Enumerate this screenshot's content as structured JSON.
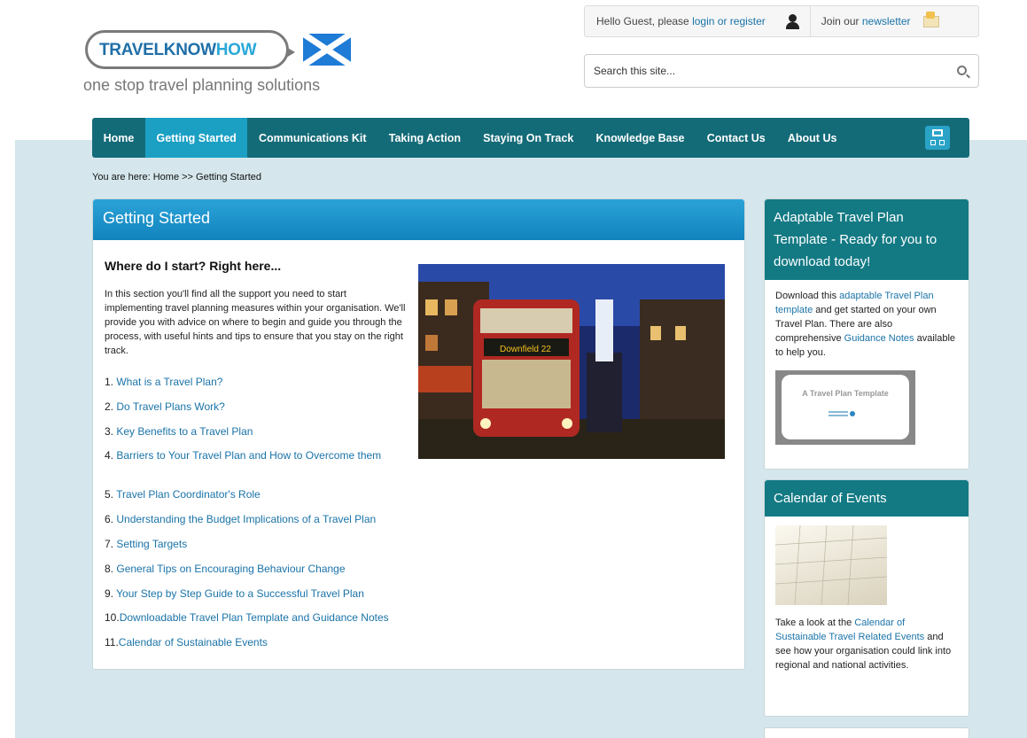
{
  "logo": {
    "text_a": "TRAVELKNOW",
    "text_b": "HOW",
    "tagline": "one stop travel planning solutions"
  },
  "userbar": {
    "greeting": "Hello Guest, please",
    "login_link": "login or register",
    "newsletter_prefix": "Join our",
    "newsletter_link": "newsletter"
  },
  "search": {
    "placeholder": "Search this site..."
  },
  "nav": {
    "items": [
      "Home",
      "Getting Started",
      "Communications Kit",
      "Taking Action",
      "Staying On Track",
      "Knowledge Base",
      "Contact Us",
      "About Us"
    ],
    "active": "Getting Started"
  },
  "breadcrumb": {
    "prefix": "You are here:",
    "home": "Home",
    "sep": ">>",
    "current": "Getting Started"
  },
  "main": {
    "title": "Getting Started",
    "heading": "Where do I start? Right here...",
    "intro": "In this section you'll find all the support you need to start implementing travel planning measures within your organisation. We'll provide you with advice on where to begin and guide you through the process, with useful hints and tips to ensure that you stay on the right track.",
    "topics": [
      {
        "num": "1.",
        "label": "What is a Travel Plan?"
      },
      {
        "num": "2.",
        "label": "Do Travel Plans Work?"
      },
      {
        "num": "3.",
        "label": "Key Benefits to a Travel Plan"
      },
      {
        "num": "4.",
        "label": "Barriers to Your Travel Plan and How to Overcome them"
      },
      {
        "num": "5.",
        "label": "Travel Plan Coordinator's Role"
      },
      {
        "num": "6.",
        "label": "Understanding the Budget Implications of a Travel Plan"
      },
      {
        "num": "7.",
        "label": "Setting Targets"
      },
      {
        "num": "8.",
        "label": "General Tips on Encouraging Behaviour Change"
      },
      {
        "num": "9.",
        "label": "Your Step by Step Guide to a Successful Travel Plan"
      },
      {
        "num": "10.",
        "label": "Downloadable Travel Plan Template and Guidance Notes"
      },
      {
        "num": "11.",
        "label": "Calendar of Sustainable Events"
      }
    ],
    "image_sign": "Downfield 22"
  },
  "sidebar": {
    "template_box": {
      "title": "Adaptable Travel Plan Template - Ready for you to download today!",
      "text_1": "Download this",
      "link_1": "adaptable Travel Plan template",
      "text_2": "and get started on your own Travel Plan. There are also comprehensive",
      "link_2": "Guidance Notes",
      "text_3": "available to help you.",
      "thumb_title": "A Travel Plan Template"
    },
    "calendar_box": {
      "title": "Calendar of Events",
      "text_1": "Take a look at the",
      "link_1": "Calendar of Sustainable Travel Related Events",
      "text_2": "and see how your organisation could link into regional and national activities."
    }
  }
}
